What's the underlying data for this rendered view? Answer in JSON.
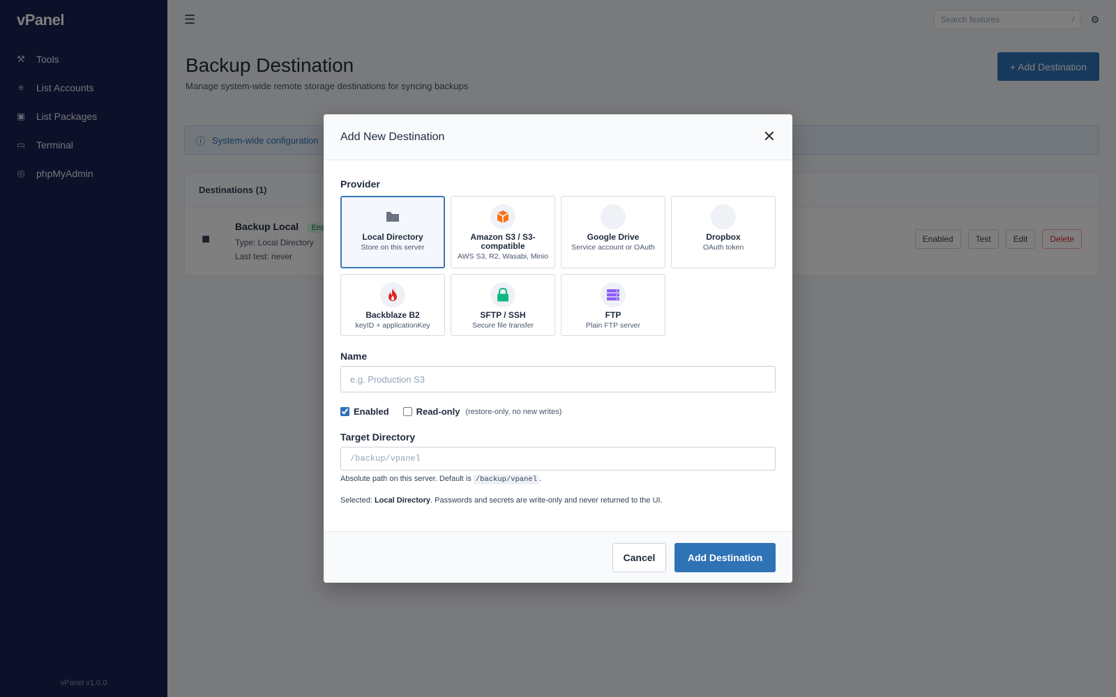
{
  "sidebar": {
    "logo": "vPanel",
    "items": [
      {
        "label": "Tools",
        "icon": "wrench-icon"
      },
      {
        "label": "List Accounts",
        "icon": "list-icon"
      },
      {
        "label": "List Packages",
        "icon": "package-icon"
      },
      {
        "label": "Terminal",
        "icon": "terminal-icon"
      },
      {
        "label": "phpMyAdmin",
        "icon": "database-icon"
      }
    ],
    "footer": "vPanel v1.0.0"
  },
  "topbar": {
    "search_placeholder": "Search features",
    "search_shortcut": "/"
  },
  "page": {
    "title": "Backup Destination",
    "subtitle": "Manage system-wide remote storage destinations for syncing backups",
    "add_button": "+ Add Destination",
    "info": "System-wide configuration",
    "destinations_header": "Destinations (1)",
    "dest_name": "Backup Local",
    "dest_badge": "Enabled",
    "dest_type": "Type: Local Directory",
    "dest_detail": "Last test: never",
    "actions": [
      "Enabled",
      "Test",
      "Edit",
      "Delete"
    ]
  },
  "modal": {
    "title": "Add New Destination",
    "close_glyph": "✕",
    "provider_label": "Provider",
    "providers": [
      {
        "name": "Local Directory",
        "desc": "Store on this server",
        "icon": "folder-icon",
        "color": "#6b7280"
      },
      {
        "name": "Amazon S3 / S3-compatible",
        "desc": "AWS S3, R2, Wasabi, Minio",
        "icon": "cube-icon",
        "color": "#f97316"
      },
      {
        "name": "Google Drive",
        "desc": "Service account or OAuth",
        "icon": "google-drive-icon",
        "color": "#eef1f5"
      },
      {
        "name": "Dropbox",
        "desc": "OAuth token",
        "icon": "dropbox-icon",
        "color": "#eef1f5"
      },
      {
        "name": "Backblaze B2",
        "desc": "keyID + applicationKey",
        "icon": "flame-icon",
        "color": "#dc2626"
      },
      {
        "name": "SFTP / SSH",
        "desc": "Secure file transfer",
        "icon": "lock-icon",
        "color": "#10b981"
      },
      {
        "name": "FTP",
        "desc": "Plain FTP server",
        "icon": "server-icon",
        "color": "#8b5cf6"
      }
    ],
    "name_label": "Name",
    "name_value": "",
    "name_placeholder": "e.g. Production S3",
    "enabled_label": "Enabled",
    "enabled_checked": true,
    "readonly_label": "Read-only",
    "readonly_checked": false,
    "readonly_hint": "(restore-only, no new writes)",
    "target_label": "Target Directory",
    "target_value": "",
    "target_placeholder": "/backup/vpanel",
    "help_prefix": "Absolute path on this server. Default is",
    "help_code": "/backup/vpanel",
    "help_suffix": ".",
    "selected_prefix": "Selected:",
    "selected_provider": "Local Directory",
    "selected_suffix": ". Passwords and secrets are write-only and never returned to the UI.",
    "cancel_label": "Cancel",
    "submit_label": "Add Destination"
  }
}
